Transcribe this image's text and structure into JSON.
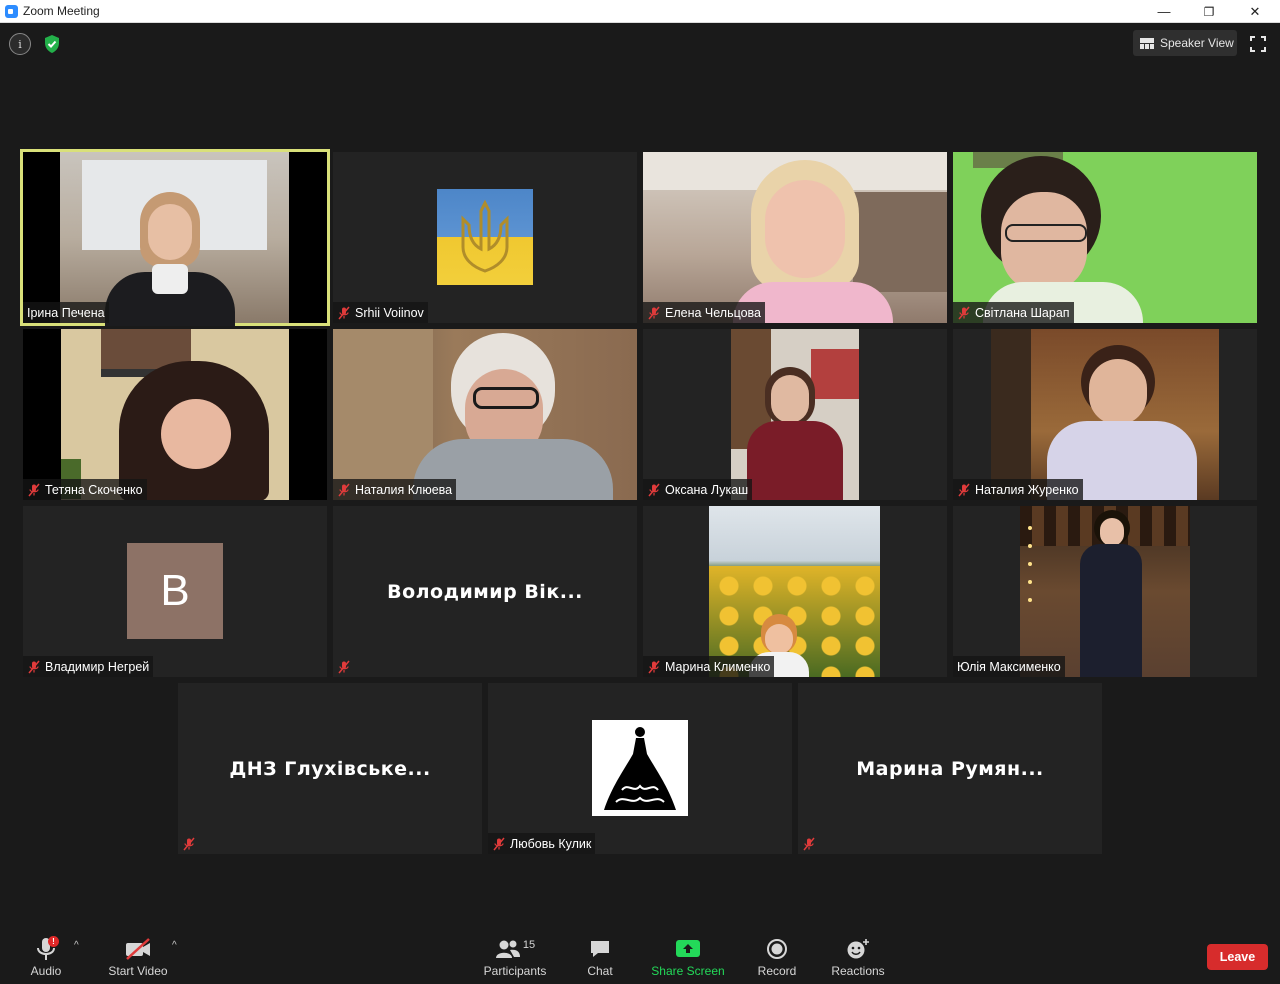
{
  "window": {
    "title": "Zoom Meeting",
    "minimize": "—",
    "restore": "❐",
    "close": "✕"
  },
  "topbar": {
    "speaker_view_label": "Speaker View"
  },
  "participants": [
    {
      "name": "Ірина Печена",
      "muted": false,
      "video": true,
      "active": true
    },
    {
      "name": "Srhii Voiinov",
      "muted": true,
      "video": false,
      "avatar": "trident-flag"
    },
    {
      "name": "Елена Чельцова",
      "muted": true,
      "video": true
    },
    {
      "name": "Світлана Шарап",
      "muted": true,
      "video": true
    },
    {
      "name": "Тетяна Скоченко",
      "muted": true,
      "video": true
    },
    {
      "name": "Наталия Клюева",
      "muted": true,
      "video": true
    },
    {
      "name": "Оксана Лукаш",
      "muted": true,
      "video": true
    },
    {
      "name": "Наталия Журенко",
      "muted": true,
      "video": true
    },
    {
      "name": "Владимир Негрей",
      "muted": true,
      "video": false,
      "avatar_letter": "B"
    },
    {
      "name": "Володимир  Вік...",
      "muted": true,
      "video": false
    },
    {
      "name": "Марина Клименко",
      "muted": true,
      "video": true
    },
    {
      "name": "Юлія Максименко",
      "muted": false,
      "video": true
    },
    {
      "name": "ДНЗ  Глухівське...",
      "muted": true,
      "video": false
    },
    {
      "name": "Любовь Кулик",
      "muted": true,
      "video": false,
      "avatar": "dress-silhouette"
    },
    {
      "name": "Марина  Румян...",
      "muted": true,
      "video": false
    }
  ],
  "toolbar": {
    "audio_label": "Audio",
    "audio_badge": "!",
    "start_video_label": "Start Video",
    "participants_label": "Participants",
    "participants_count": "15",
    "chat_label": "Chat",
    "share_screen_label": "Share Screen",
    "record_label": "Record",
    "reactions_label": "Reactions",
    "leave_label": "Leave",
    "caret": "^"
  },
  "colors": {
    "active_border": "#d9e07a",
    "share_green": "#23d959",
    "leave_red": "#d72c2c",
    "tile_bg": "#232323"
  }
}
